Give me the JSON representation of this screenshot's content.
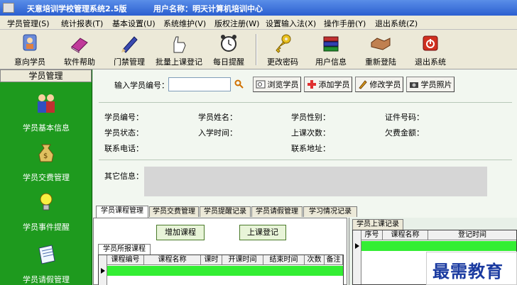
{
  "window": {
    "title": "天意培训学校管理系统2.5版",
    "user_label": "用户名称：明天计算机培训中心"
  },
  "menu": [
    "学员管理(S)",
    "统计报表(T)",
    "基本设置(U)",
    "系统维护(V)",
    "版权注册(W)",
    "设置输入法(X)",
    "操作手册(Y)",
    "退出系统(Z)"
  ],
  "toolbar": [
    {
      "label": "意向学员",
      "icon": "person-icon"
    },
    {
      "label": "软件帮助",
      "icon": "book-icon"
    },
    {
      "label": "门禁管理",
      "icon": "pen-icon"
    },
    {
      "label": "批量上课登记",
      "icon": "hand-icon"
    },
    {
      "label": "每日提醒",
      "icon": "alarm-clock-icon"
    },
    {
      "label": "更改密码",
      "icon": "key-icon"
    },
    {
      "label": "用户信息",
      "icon": "books-icon"
    },
    {
      "label": "重新登陆",
      "icon": "handshake-icon"
    },
    {
      "label": "退出系统",
      "icon": "power-icon"
    }
  ],
  "sidebar": {
    "title": "学员管理",
    "items": [
      {
        "label": "学员基本信息",
        "icon": "students-icon"
      },
      {
        "label": "学员交费管理",
        "icon": "money-bag-icon"
      },
      {
        "label": "学员事件提醒",
        "icon": "lightbulb-icon"
      },
      {
        "label": "学员请假管理",
        "icon": "notepad-icon"
      }
    ]
  },
  "search": {
    "label": "输入学员编号：",
    "value": "",
    "browse_button": "浏览学员",
    "add_button": "添加学员",
    "edit_button": "修改学员",
    "photo_button": "学员照片"
  },
  "fields": {
    "student_id": "学员编号：",
    "student_name": "学员姓名：",
    "gender": "学员性别：",
    "id_number": "证件号码：",
    "status": "学员状态：",
    "enroll_time": "入学时间：",
    "class_count": "上课次数：",
    "arrears": "欠费金额：",
    "phone": "联系电话：",
    "address": "联系地址：",
    "other_info": "其它信息："
  },
  "tabs": [
    "学员课程管理",
    "学员交费管理",
    "学员提醒记录",
    "学员请假管理",
    "学习情况记录"
  ],
  "course_panel": {
    "add_course_button": "增加课程",
    "class_register_button": "上课登记",
    "subtab": "学员所报课程",
    "columns": [
      "课程编号",
      "课程名称",
      "课时",
      "开课时间",
      "结束时间",
      "次数",
      "备注"
    ]
  },
  "class_record": {
    "subtab": "学员上课记录",
    "columns": [
      "序号",
      "课程名称",
      "登记时间"
    ]
  },
  "watermark": "最需教育",
  "colors": {
    "sidebar_bg": "#1e9a1e",
    "title_bar": "#2b5fd0",
    "row_highlight": "#33ee33"
  }
}
